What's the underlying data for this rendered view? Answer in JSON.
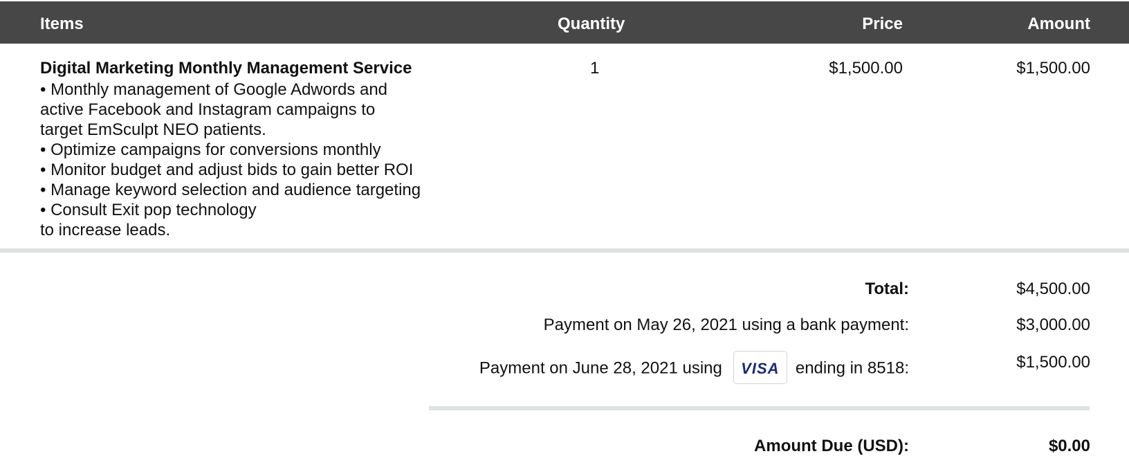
{
  "table": {
    "headers": {
      "items": "Items",
      "quantity": "Quantity",
      "price": "Price",
      "amount": "Amount"
    },
    "rows": [
      {
        "name": "Digital Marketing Monthly Management Service",
        "description": "• Monthly management of Google Adwords and\nactive  Facebook and Instagram campaigns to\ntarget EmSculpt NEO patients.\n• Optimize campaigns for conversions monthly\n• Monitor budget and adjust bids to gain better ROI\n• Manage keyword selection and audience targeting\n• Consult Exit pop technology\nto increase leads.",
        "quantity": "1",
        "price": "$1,500.00",
        "amount": "$1,500.00"
      }
    ]
  },
  "summary": {
    "total_label": "Total:",
    "total_value": "$4,500.00",
    "payments": [
      {
        "label": "Payment on May 26, 2021 using a bank payment:",
        "value": "$3,000.00"
      },
      {
        "label_prefix": "Payment on June 28, 2021 using",
        "card_brand": "VISA",
        "label_suffix": "ending in 8518:",
        "value": "$1,500.00"
      }
    ],
    "amount_due_label": "Amount Due (USD):",
    "amount_due_value": "$0.00"
  },
  "colors": {
    "header_bg": "#474747",
    "divider": "#dde2e2",
    "visa_blue": "#1a2a78"
  },
  "icons": {
    "card_brand": "visa-icon"
  }
}
